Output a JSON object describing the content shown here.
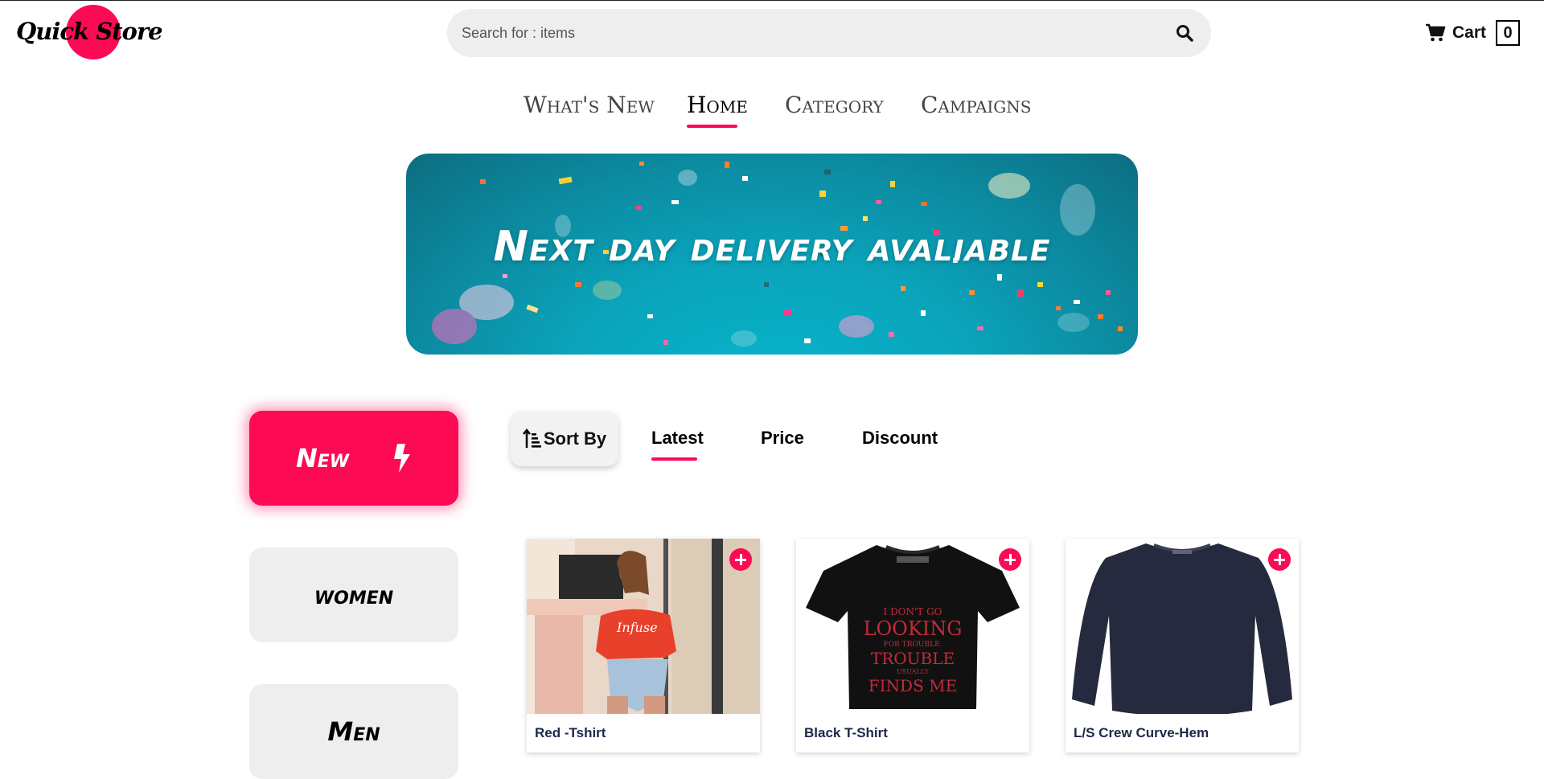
{
  "header": {
    "logo_text": "Quick Store",
    "search_placeholder": "Search for : items",
    "cart_label": "Cart",
    "cart_count": "0"
  },
  "nav": {
    "items": [
      {
        "label": "What's New"
      },
      {
        "label": "Home",
        "active": true
      },
      {
        "label": "Category"
      },
      {
        "label": "Campaigns"
      }
    ]
  },
  "banner": {
    "text": "Next day delivery avaliable"
  },
  "categories": [
    {
      "label": "New",
      "active": true,
      "icon": "lightning-icon"
    },
    {
      "label": "women"
    },
    {
      "label": "Men"
    }
  ],
  "sort": {
    "label": "Sort By",
    "options": [
      {
        "label": "Latest",
        "active": true
      },
      {
        "label": "Price"
      },
      {
        "label": "Discount"
      }
    ]
  },
  "products": [
    {
      "name": "Red -Tshirt"
    },
    {
      "name": "Black T-Shirt",
      "print_text": "I DON'T GO LOOKING FOR TROUBLE. TROUBLE USUALLY FINDS ME"
    },
    {
      "name": "L/S Crew Curve-Hem"
    }
  ],
  "colors": {
    "accent": "#fd0a54",
    "button_bg": "#eeeeee",
    "banner": "#0aa4bb",
    "product_name": "#1d2748"
  }
}
